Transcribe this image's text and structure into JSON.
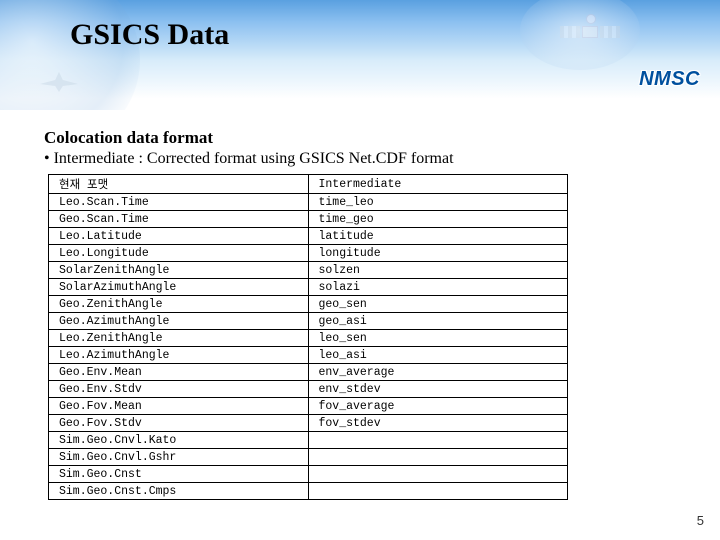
{
  "header": {
    "title": "GSICS Data",
    "logo": "NMSC"
  },
  "body": {
    "subheading": "Colocation data format",
    "bullet": "• Intermediate : Corrected format using GSICS Net.CDF format"
  },
  "table": {
    "header_left": "현재 포맷",
    "header_right": "Intermediate",
    "rows": [
      {
        "left": "Leo.Scan.Time",
        "right": "time_leo"
      },
      {
        "left": "Geo.Scan.Time",
        "right": "time_geo"
      },
      {
        "left": "Leo.Latitude",
        "right": "latitude"
      },
      {
        "left": "Leo.Longitude",
        "right": "longitude"
      },
      {
        "left": "SolarZenithAngle",
        "right": "solzen"
      },
      {
        "left": "SolarAzimuthAngle",
        "right": "solazi"
      },
      {
        "left": "Geo.ZenithAngle",
        "right": "geo_sen"
      },
      {
        "left": "Geo.AzimuthAngle",
        "right": "geo_asi"
      },
      {
        "left": "Leo.ZenithAngle",
        "right": "leo_sen"
      },
      {
        "left": "Leo.AzimuthAngle",
        "right": "leo_asi"
      },
      {
        "left": "Geo.Env.Mean",
        "right": "env_average"
      },
      {
        "left": "Geo.Env.Stdv",
        "right": "env_stdev"
      },
      {
        "left": "Geo.Fov.Mean",
        "right": "fov_average"
      },
      {
        "left": "Geo.Fov.Stdv",
        "right": "fov_stdev"
      },
      {
        "left": "Sim.Geo.Cnvl.Kato",
        "right": ""
      },
      {
        "left": "Sim.Geo.Cnvl.Gshr",
        "right": ""
      },
      {
        "left": "Sim.Geo.Cnst",
        "right": ""
      },
      {
        "left": "Sim.Geo.Cnst.Cmps",
        "right": ""
      }
    ]
  },
  "page_number": "5"
}
